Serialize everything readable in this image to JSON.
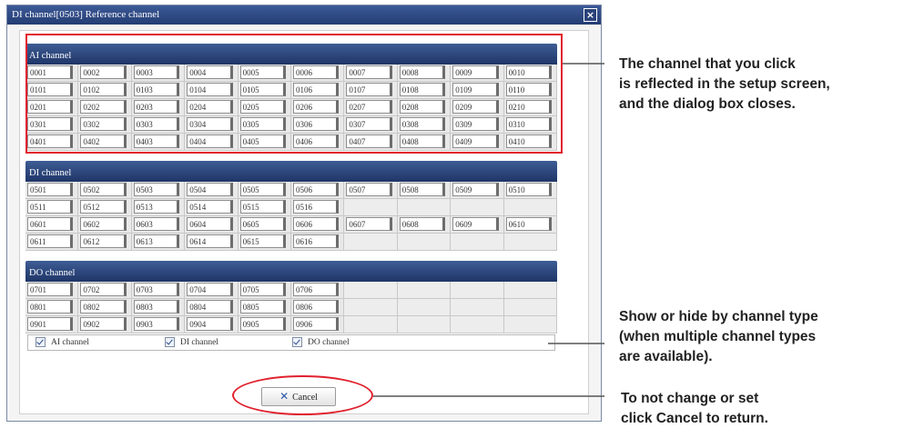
{
  "dialog": {
    "title": "DI channel[0503] Reference channel",
    "close_symbol": "×"
  },
  "sections": {
    "ai": {
      "header": "AI channel",
      "rows": [
        [
          "0001",
          "0002",
          "0003",
          "0004",
          "0005",
          "0006",
          "0007",
          "0008",
          "0009",
          "0010"
        ],
        [
          "0101",
          "0102",
          "0103",
          "0104",
          "0105",
          "0106",
          "0107",
          "0108",
          "0109",
          "0110"
        ],
        [
          "0201",
          "0202",
          "0203",
          "0204",
          "0205",
          "0206",
          "0207",
          "0208",
          "0209",
          "0210"
        ],
        [
          "0301",
          "0302",
          "0303",
          "0304",
          "0305",
          "0306",
          "0307",
          "0308",
          "0309",
          "0310"
        ],
        [
          "0401",
          "0402",
          "0403",
          "0404",
          "0405",
          "0406",
          "0407",
          "0408",
          "0409",
          "0410"
        ]
      ]
    },
    "di": {
      "header": "DI channel",
      "rows": [
        [
          "0501",
          "0502",
          "0503",
          "0504",
          "0505",
          "0506",
          "0507",
          "0508",
          "0509",
          "0510"
        ],
        [
          "0511",
          "0512",
          "0513",
          "0514",
          "0515",
          "0516",
          "",
          "",
          "",
          ""
        ],
        [
          "0601",
          "0602",
          "0603",
          "0604",
          "0605",
          "0606",
          "0607",
          "0608",
          "0609",
          "0610"
        ],
        [
          "0611",
          "0612",
          "0613",
          "0614",
          "0615",
          "0616",
          "",
          "",
          "",
          ""
        ]
      ]
    },
    "do": {
      "header": "DO channel",
      "rows": [
        [
          "0701",
          "0702",
          "0703",
          "0704",
          "0705",
          "0706",
          "",
          "",
          "",
          ""
        ],
        [
          "0801",
          "0802",
          "0803",
          "0804",
          "0805",
          "0806",
          "",
          "",
          "",
          ""
        ],
        [
          "0901",
          "0902",
          "0903",
          "0904",
          "0905",
          "0906",
          "",
          "",
          "",
          ""
        ]
      ]
    }
  },
  "filters": {
    "ai": {
      "label": "AI channel",
      "checked": true
    },
    "di": {
      "label": "DI channel",
      "checked": true
    },
    "do": {
      "label": "DO channel",
      "checked": true
    }
  },
  "cancel_button": {
    "label": "Cancel",
    "icon": "x-icon"
  },
  "annotations": {
    "top": [
      "The channel that you click",
      "is reflected in the setup screen,",
      "and the dialog box closes."
    ],
    "middle": [
      "Show or hide by channel type",
      "(when multiple channel types",
      "are available)."
    ],
    "bottom": [
      "To not change or set",
      "click Cancel to return."
    ]
  },
  "colors": {
    "highlight": "#e0212e",
    "header": "#2a4478"
  }
}
